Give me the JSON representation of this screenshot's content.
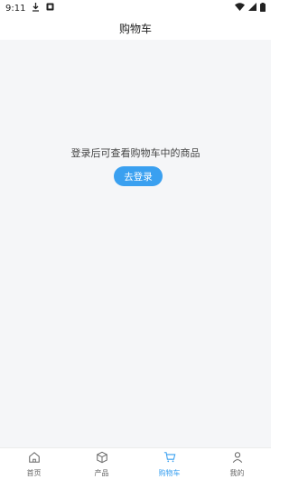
{
  "status_bar": {
    "time": "9:11",
    "icons": [
      "download-icon",
      "app-notification-icon",
      "wifi-icon",
      "signal-icon",
      "battery-icon"
    ]
  },
  "header": {
    "title": "购物车"
  },
  "main": {
    "empty_message": "登录后可查看购物车中的商品",
    "login_button_label": "去登录"
  },
  "tab_bar": {
    "items": [
      {
        "label": "首页",
        "icon": "home-icon",
        "active": false
      },
      {
        "label": "产品",
        "icon": "cube-icon",
        "active": false
      },
      {
        "label": "购物车",
        "icon": "cart-icon",
        "active": true
      },
      {
        "label": "我的",
        "icon": "user-icon",
        "active": false
      }
    ]
  },
  "colors": {
    "accent": "#3aa0f0",
    "background": "#f5f6f8"
  }
}
